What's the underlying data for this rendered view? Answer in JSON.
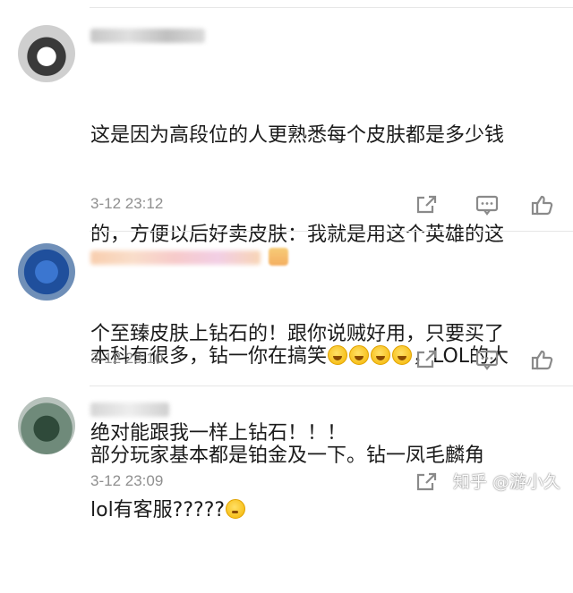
{
  "comments": [
    {
      "lines": [
        "这是因为高段位的人更熟悉每个皮肤都是多少钱",
        "的，方便以后好卖皮肤：我就是用这个英雄的这",
        "个至臻皮肤上钻石的！跟你说贼好用，只要买了",
        "绝对能跟我一样上钻石！！！"
      ],
      "time": "3-12 23:12"
    },
    {
      "line1_before_emoji": "本科有很多，钻一你在搞笑",
      "line1_after_emoji": "，LOL的大",
      "line2": "部分玩家基本都是铂金及一下。钻一凤毛麟角",
      "emoji_name": "laugh-cry-emoji",
      "time": "3-12 23:10"
    },
    {
      "text": "lol有客服?????",
      "emoji_name": "thinking-emoji",
      "time": "3-12 23:09"
    }
  ],
  "icons": {
    "share": "share-icon",
    "comment": "comment-icon",
    "like": "thumbs-up-icon"
  },
  "colors": {
    "text": "#1a1a1a",
    "meta": "#8f8f8f",
    "icon": "#8a8a8a",
    "divider": "#e6e6e6"
  },
  "watermark": "知乎 @游小久"
}
